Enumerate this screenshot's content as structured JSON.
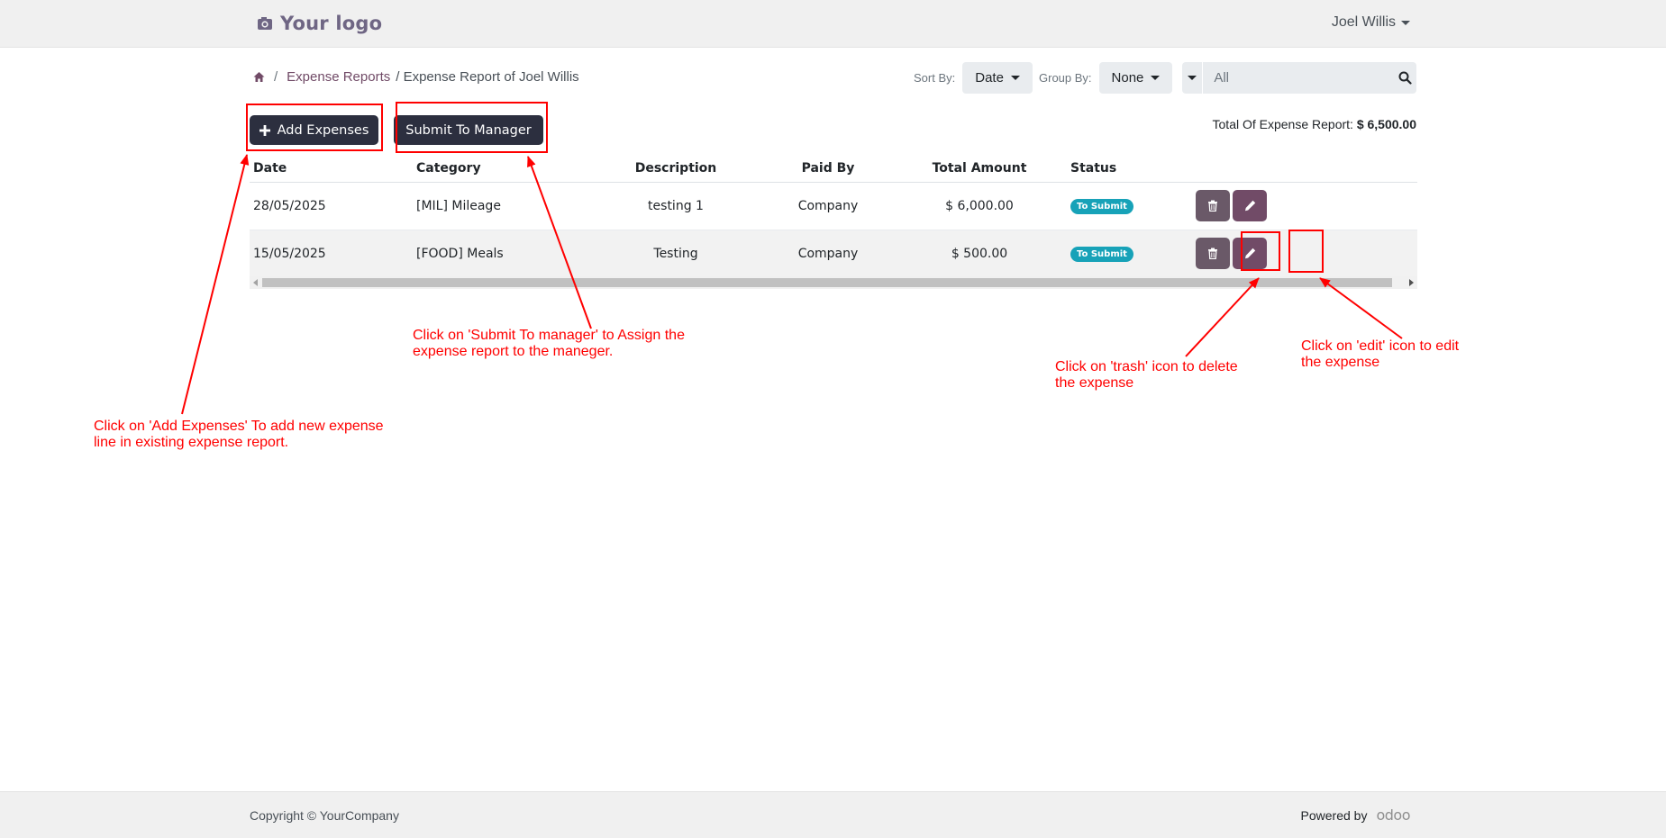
{
  "header": {
    "logo_text": "Your logo",
    "logo_icon": "camera-icon",
    "user_name": "Joel Willis"
  },
  "breadcrumb": {
    "home_icon": "home-icon",
    "separator": "/",
    "link": "Expense Reports",
    "current": "/ Expense Report of Joel Willis"
  },
  "controls": {
    "sort_label": "Sort By:",
    "sort_value": "Date",
    "group_label": "Group By:",
    "group_value": "None",
    "search_placeholder": "All",
    "search_icon": "search-icon"
  },
  "actions": {
    "add_expenses": "Add Expenses",
    "add_icon": "plus-icon",
    "submit_manager": "Submit To Manager"
  },
  "total": {
    "label": "Total Of Expense Report:",
    "value": "$ 6,500.00"
  },
  "table": {
    "headers": [
      "Date",
      "Category",
      "Description",
      "Paid By",
      "Total Amount",
      "Status"
    ],
    "rows": [
      {
        "date": "28/05/2025",
        "category": "[MIL] Mileage",
        "description": "testing 1",
        "paid_by": "Company",
        "amount": "$ 6,000.00",
        "status": "To Submit"
      },
      {
        "date": "15/05/2025",
        "category": "[FOOD] Meals",
        "description": "Testing",
        "paid_by": "Company",
        "amount": "$ 500.00",
        "status": "To Submit"
      }
    ],
    "row_icons": [
      "trash-icon",
      "pencil-icon"
    ]
  },
  "annotations": {
    "add_note": "Click on 'Add Expenses' To add new expense line in existing expense report.",
    "submit_note": "Click on 'Submit To manager' to Assign the expense report to the maneger.",
    "trash_note": "Click on 'trash' icon to delete the expense",
    "edit_note": "Click on 'edit' icon to edit the expense",
    "color": "#ff0000"
  },
  "footer": {
    "copyright": "Copyright © YourCompany",
    "powered_by": "Powered by",
    "odoo": "odoo"
  },
  "colors": {
    "primary": "#714b67",
    "dark_button": "#2c2f3f",
    "badge": "#17a2b8",
    "bar": "#f0f0f0"
  }
}
